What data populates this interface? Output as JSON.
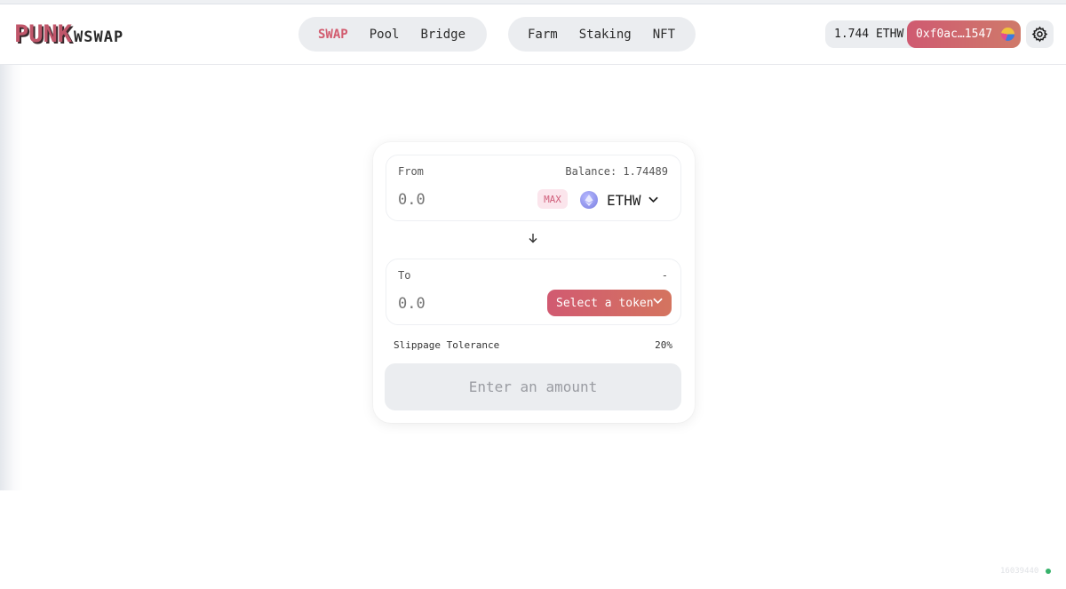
{
  "brand": {
    "logo_big": "PUNK",
    "logo_small": "WSWAP"
  },
  "nav": {
    "primary": [
      {
        "label": "SWAP",
        "active": true
      },
      {
        "label": "Pool"
      },
      {
        "label": "Bridge"
      }
    ],
    "secondary": [
      {
        "label": "Farm"
      },
      {
        "label": "Staking"
      },
      {
        "label": "NFT"
      }
    ]
  },
  "wallet": {
    "balance": "1.744 ETHW",
    "address": "0xf0ac…1547",
    "avatar_icon": "wallet-avatar-icon"
  },
  "settings": {
    "icon": "gear-icon"
  },
  "swap": {
    "from": {
      "label": "From",
      "balance_text": "Balance: 1.74489",
      "amount_placeholder": "0.0",
      "max_label": "MAX",
      "token": "ETHW"
    },
    "to": {
      "label": "To",
      "balance_text": "-",
      "amount_placeholder": "0.0",
      "select_label": "Select a token"
    },
    "slippage_label": "Slippage Tolerance",
    "slippage_value": "20%",
    "action_label": "Enter an amount"
  },
  "footer": {
    "block": "16039440"
  },
  "colors": {
    "accent": "#d25c6f",
    "surface": "#ebedf0",
    "status_ok": "#37b26b"
  }
}
